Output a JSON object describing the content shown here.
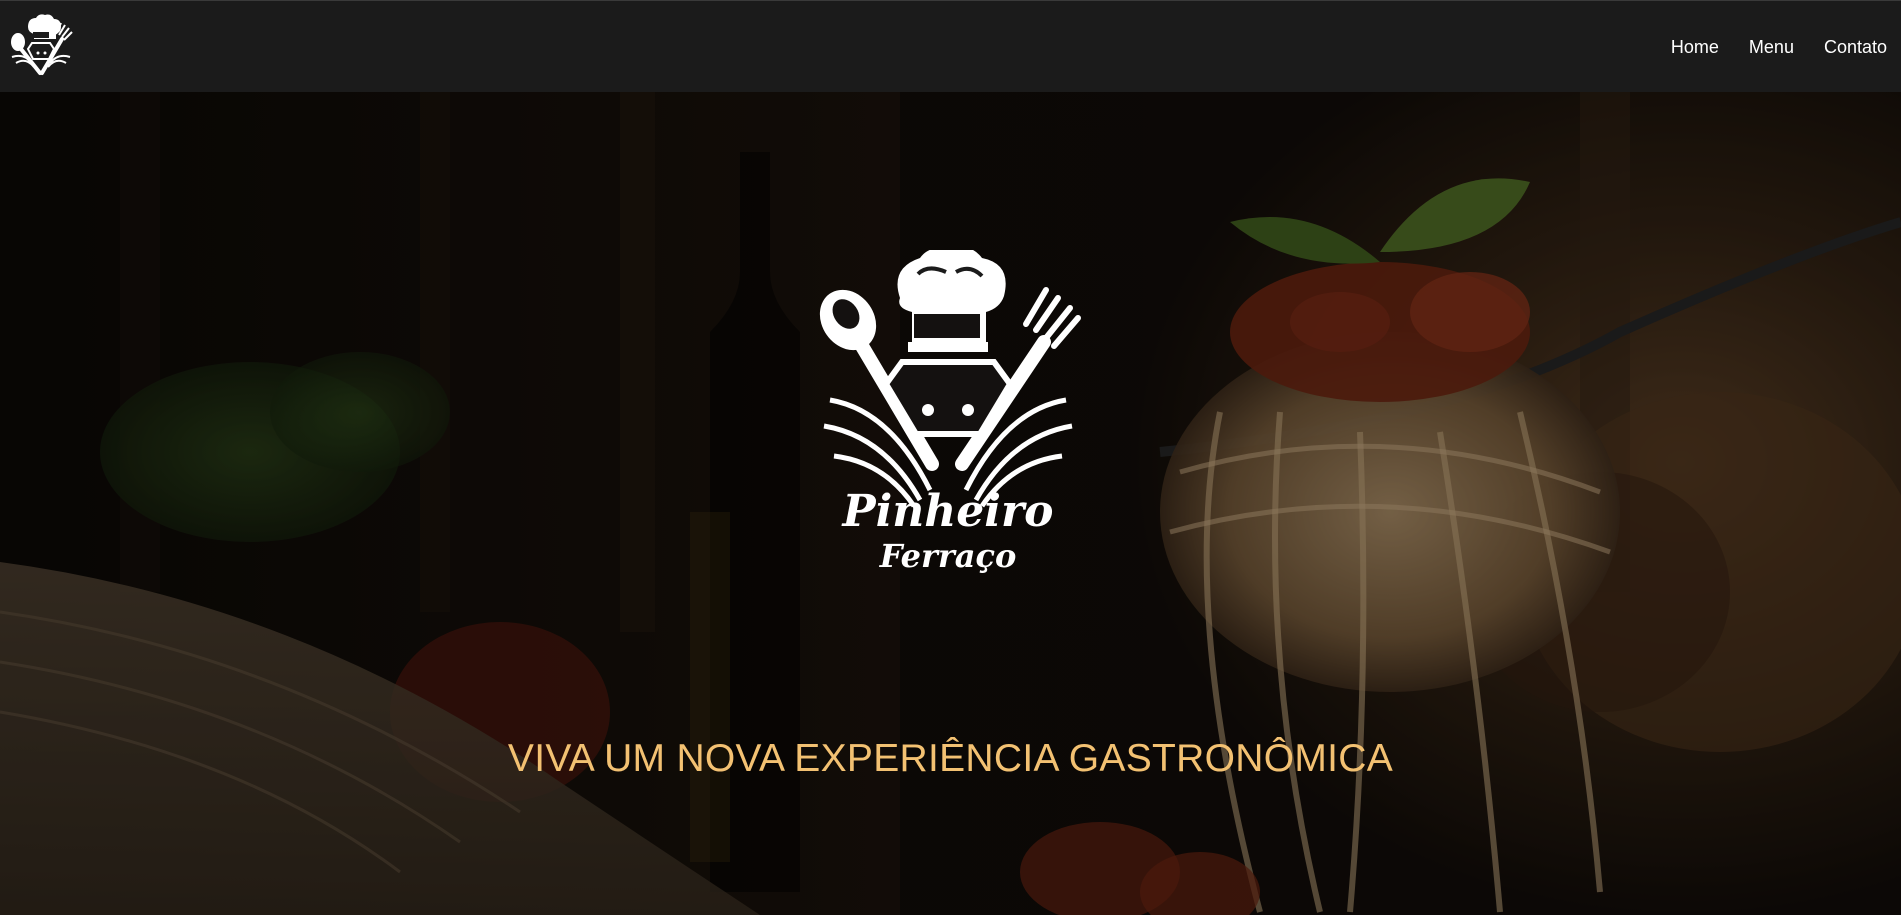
{
  "brand": {
    "logo_icon": "chef-hat-cutlery-logo-icon",
    "logo_name_line1": "Pinheiro",
    "logo_name_line2": "Ferraço"
  },
  "nav": {
    "items": [
      {
        "label": "Home"
      },
      {
        "label": "Menu"
      },
      {
        "label": "Contato"
      }
    ]
  },
  "hero": {
    "background": "spaghetti-on-fork-photo",
    "heading": "VIVA UM NOVA EXPERIÊNCIA GASTRONÔMICA"
  },
  "colors": {
    "navbar_bg": "#1b1b1b",
    "nav_text": "#ffffff",
    "heading_text": "#f3c172",
    "logo": "#ffffff"
  }
}
